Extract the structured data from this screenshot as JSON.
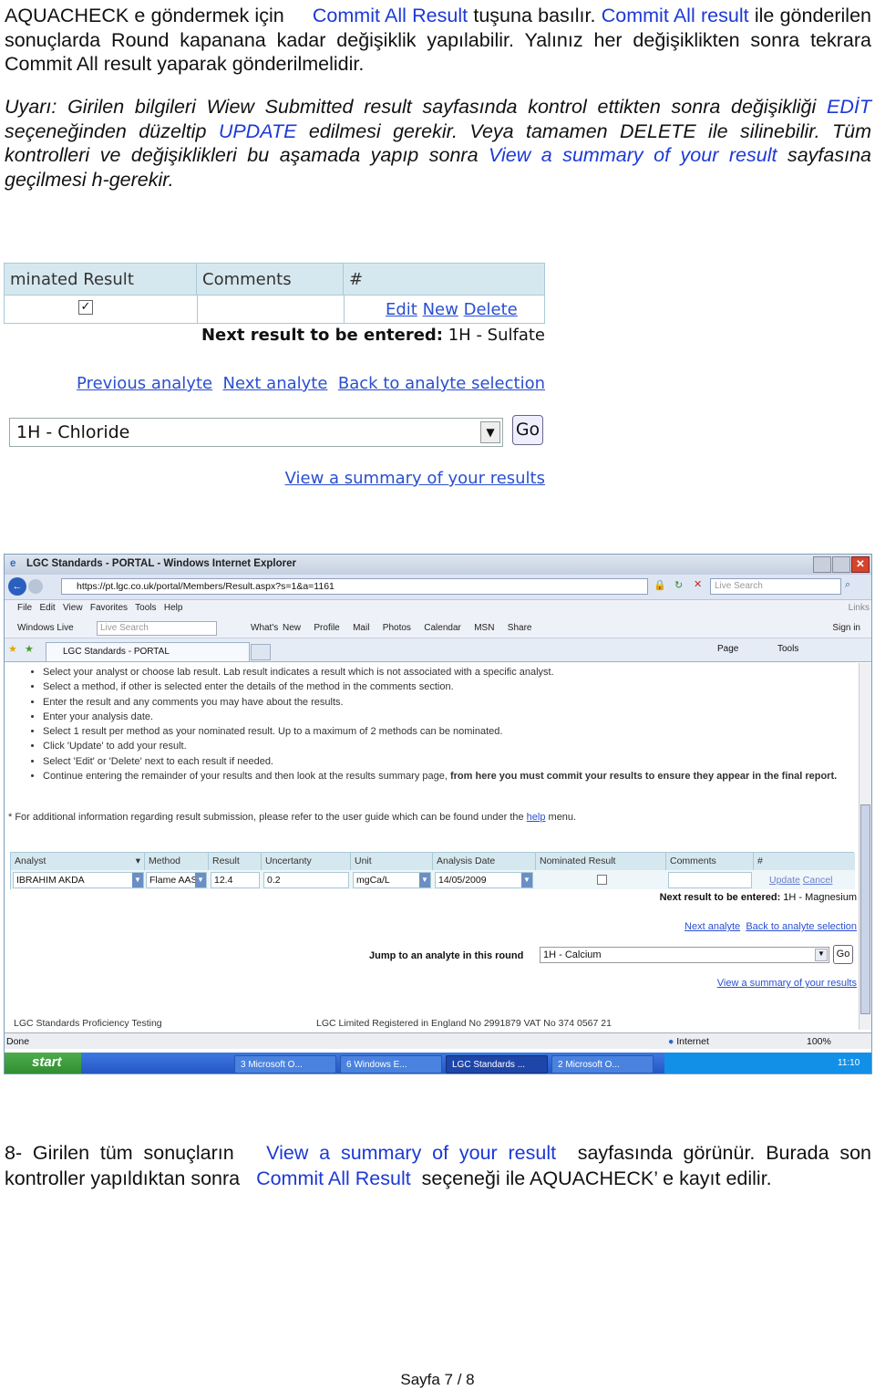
{
  "para1": {
    "t1": "AQUACHECK e göndermek için",
    "l1": "Commit All Result",
    "t2": "tuşuna basılır.",
    "l2": "Commit All",
    "l3": "result",
    "t3": "ile gönderilen sonuçlarda Round kapanana kadar değişiklik yapılabilir. Yalınız her değişiklikten sonra tekrara Commit All result yaparak gönderilmelidir."
  },
  "para2": {
    "t1": "Uyarı: Girilen bilgileri Wiew Submitted result sayfasında kontrol ettikten sonra değişikliği",
    "l1": "EDİT",
    "t2": "seçeneğinden düzeltip",
    "l2": "UPDATE",
    "t3": "edilmesi gerekir. Veya tamamen DELETE ile silinebilir. Tüm kontrolleri ve değişiklikleri bu aşamada yapıp sonra",
    "l3": "View a summary of your result",
    "t4": "sayfasına geçilmesi h-gerekir."
  },
  "shot1": {
    "headers": [
      "minated Result",
      "Comments",
      "#"
    ],
    "actions": [
      "Edit",
      "New",
      "Delete"
    ],
    "next_label": "Next result to be entered:",
    "next_value": "1H - Sulfate",
    "links": [
      "Previous analyte",
      "Next analyte",
      "Back to analyte selection"
    ],
    "select_value": "1H - Chloride",
    "go": "Go",
    "summary_link": "View a summary of your results"
  },
  "ie": {
    "title": "LGC Standards - PORTAL - Windows Internet Explorer",
    "url": "https://pt.lgc.co.uk/portal/Members/Result.aspx?s=1&a=1161",
    "search_placeholder": "Live Search",
    "menu": [
      "File",
      "Edit",
      "View",
      "Favorites",
      "Tools",
      "Help"
    ],
    "links_label": "Links",
    "wl_label": "Windows Live",
    "wl_search": "Live Search",
    "wl_items": [
      "What's New",
      "Profile",
      "Mail",
      "Photos",
      "Calendar",
      "MSN",
      "Share"
    ],
    "sign_in": "Sign in",
    "tab": "LGC Standards - PORTAL",
    "cmd": [
      "Page",
      "Tools"
    ],
    "instructions": [
      "Select your analyst or choose lab result. Lab result indicates a result which is not associated with a specific analyst.",
      "Select a method, if other is selected enter the details of the method in the comments section.",
      "Enter the result and any comments you may have about the results.",
      "Enter your analysis date.",
      "Select 1 result per method as your nominated result. Up to a maximum of 2 methods can be nominated.",
      "Click 'Update' to add your result.",
      "Select 'Edit' or 'Delete' next to each result if needed."
    ],
    "instr_last": "Continue entering the remainder of your results and then look at the results summary page,",
    "instr_last_bold": "from here you must commit your results to ensure they appear in the final report.",
    "note": "* For additional information regarding result submission, please refer to the user guide which can be found under the",
    "note_link": "help",
    "note_end": "menu.",
    "columns": [
      "Analyst",
      "Method",
      "Result",
      "Uncertanty",
      "Unit",
      "Analysis Date",
      "Nominated Result",
      "Comments",
      "#"
    ],
    "row": {
      "analyst": "IBRAHIM AKDA",
      "method": "Flame AAS",
      "result": "12.4",
      "uncertainty": "0.2",
      "unit": "mgCa/L",
      "date": "14/05/2009",
      "comments": "",
      "update": "Update",
      "cancel": "Cancel"
    },
    "next_label": "Next result to be entered:",
    "next_value": "1H - Magnesium",
    "links": [
      "Next analyte",
      "Back to analyte selection"
    ],
    "jump_label": "Jump to an analyte in this round",
    "jump_value": "1H - Calcium",
    "go": "Go",
    "summary_link": "View a summary of your results",
    "footer_left": "LGC Standards Proficiency Testing",
    "footer_mid": "LGC Limited Registered in England No 2991879 VAT No 374 0567 21",
    "status": "Done",
    "zone": "Internet",
    "zoom": "100%",
    "start": "start",
    "tasks": [
      "3 Microsoft O...",
      "6 Windows E...",
      "LGC Standards ...",
      "2 Microsoft O..."
    ],
    "clock": "11:10"
  },
  "para3": {
    "t1": "8-  Girilen tüm sonuçların",
    "l1": "View a summary of your result",
    "t2": "sayfasında görünür. Burada son kontroller yapıldıktan sonra",
    "l2": "Commit  All  Result",
    "t3": "seçeneği ile AQUACHECK’ e kayıt edilir."
  },
  "footer": "Sayfa 7 / 8"
}
